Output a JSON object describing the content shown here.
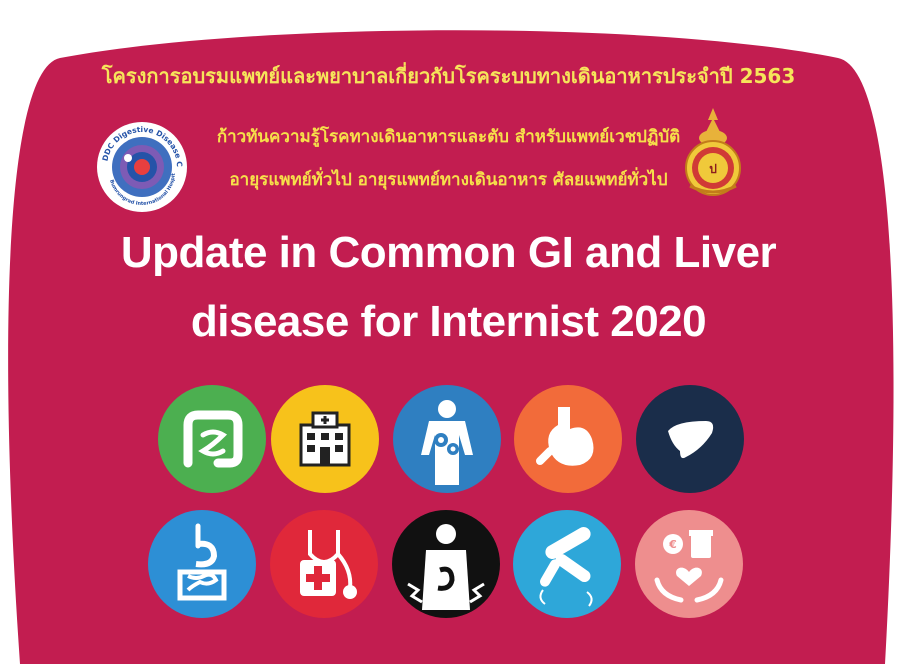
{
  "header": {
    "line1": "โครงการอบรมแพทย์และพยาบาลเกี่ยวกับโรคระบบทางเดินอาหารประจำปี 2563",
    "line2": "ก้าวทันความรู้โรคทางเดินอาหารและตับ สำหรับแพทย์เวชปฏิบัติ",
    "line3": "อายุรแพทย์ทั่วไป อายุรแพทย์ทางเดินอาหาร ศัลยแพทย์ทั่วไป"
  },
  "title": {
    "line1": "Update in Common GI and Liver",
    "line2": "disease for Internist 2020"
  },
  "logos": {
    "left": {
      "name": "ddc-digestive-disease-center-logo",
      "text": "DDC Digestive Disease Center Bumrungrad International Hospital"
    },
    "right": {
      "name": "royal-college-emblem-logo"
    }
  },
  "icons_row1": [
    {
      "name": "intestine-icon",
      "color": "#4caf50"
    },
    {
      "name": "hospital-icon",
      "color": "#f7c21b"
    },
    {
      "name": "body-gears-icon",
      "color": "#2f7fc1"
    },
    {
      "name": "stomach-icon",
      "color": "#f26b3a"
    },
    {
      "name": "liver-icon",
      "color": "#1a2d4a"
    }
  ],
  "icons_row2": [
    {
      "name": "digestive-system-icon",
      "color": "#2d8fd5"
    },
    {
      "name": "stethoscope-icon",
      "color": "#e0283a"
    },
    {
      "name": "abdominal-pain-icon",
      "color": "#111111"
    },
    {
      "name": "bacteria-icon",
      "color": "#2ea7d9"
    },
    {
      "name": "medicine-care-icon",
      "color": "#ee8e8e"
    }
  ],
  "colors": {
    "background": "#c21d50",
    "thai_text": "#f6e04a",
    "title_text": "#ffffff"
  }
}
